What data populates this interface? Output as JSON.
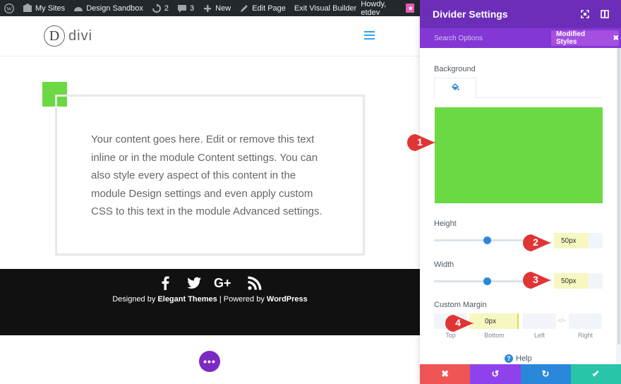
{
  "admin_bar": {
    "my_sites": "My Sites",
    "site_name": "Design Sandbox",
    "updates_count": "2",
    "comments_count": "3",
    "new_label": "New",
    "edit_page": "Edit Page",
    "exit_builder": "Exit Visual Builder",
    "howdy": "Howdy, etdev"
  },
  "site": {
    "logo_letter": "D",
    "logo_text": "divi"
  },
  "content": {
    "body_text": "Your content goes here. Edit or remove this text inline or in the module Content settings. You can also style every aspect of this content in the module Design settings and even apply custom CSS to this text in the module Advanced settings."
  },
  "footer": {
    "designed_by": "Designed by ",
    "theme_link": "Elegant Themes",
    "powered_sep": " | Powered by ",
    "wp_link": "WordPress",
    "social_icons": [
      "facebook-icon",
      "twitter-icon",
      "google-plus-icon",
      "rss-icon"
    ]
  },
  "panel": {
    "title": "Divider Settings",
    "search_options": "Search Options",
    "modified_styles": "Modified Styles",
    "background_label": "Background",
    "background_color": "#6bd944",
    "height_label": "Height",
    "height_value": "50px",
    "height_slider": 0.5,
    "width_label": "Width",
    "width_value": "50px",
    "width_slider": 0.5,
    "custom_margin_label": "Custom Margin",
    "margin": {
      "top_value": "",
      "bottom_value": "0px",
      "left_value": "",
      "right_value": "",
      "top_label": "Top",
      "bottom_label": "Bottom",
      "left_label": "Left",
      "right_label": "Right"
    },
    "help_label": "Help"
  },
  "callouts": [
    "1",
    "2",
    "3",
    "4"
  ],
  "colors": {
    "accent_purple": "#6c2eb9",
    "divider_green": "#6bd944",
    "cancel_red": "#ef5555",
    "undo_purple": "#8f42ec",
    "redo_blue": "#2b87da",
    "save_teal": "#29c4a9"
  }
}
